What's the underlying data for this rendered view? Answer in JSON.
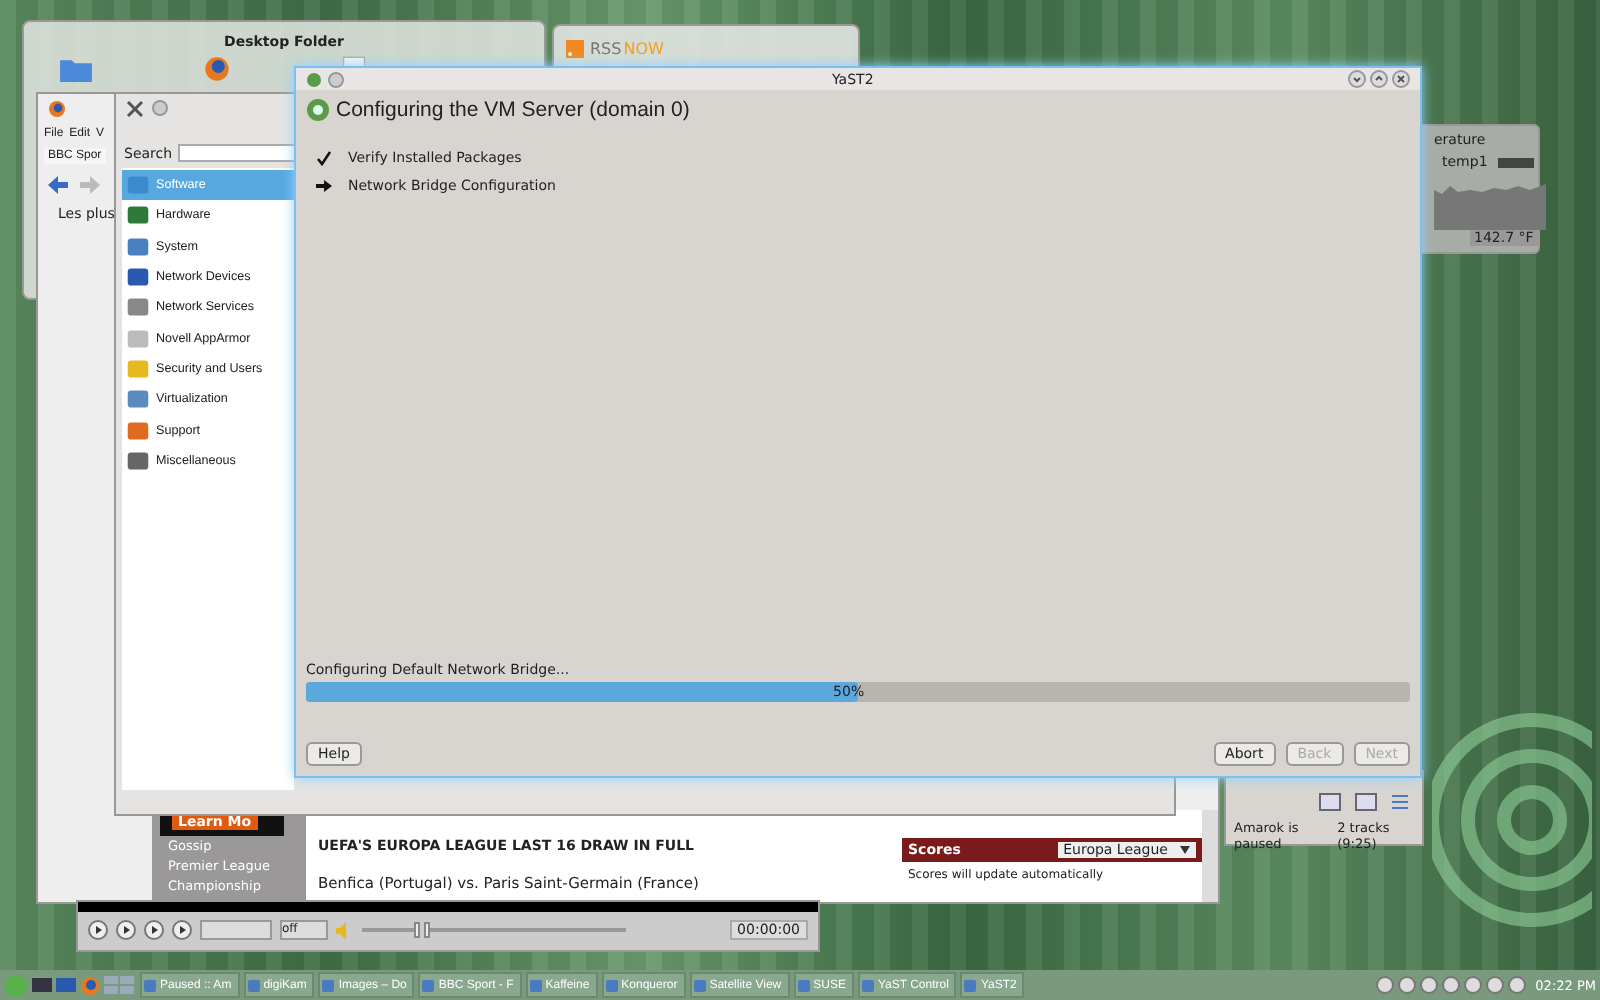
{
  "desktop_folder": {
    "title": "Desktop Folder"
  },
  "rss_widget": {
    "logo_left": "RSS",
    "logo_right": "NOW"
  },
  "browser": {
    "menu": [
      "File",
      "Edit",
      "V"
    ],
    "tab": "BBC Spor",
    "bookmark": "Les plus",
    "promo_button": "Learn Mo",
    "nav": [
      "Gossip",
      "Premier League",
      "Championship"
    ],
    "headline": "UEFA'S EUROPA LEAGUE LAST 16 DRAW IN FULL",
    "fixture": "Benfica (Portugal) vs. Paris Saint-Germain (France)",
    "scores": {
      "title": "Scores",
      "select": "Europa League",
      "note": "Scores will update automatically"
    }
  },
  "media_player": {
    "mode": "off",
    "volume": {
      "level": 0.95
    },
    "seek": {
      "level": 0
    },
    "time": "00:00:00"
  },
  "amarok": {
    "status": "Amarok is paused",
    "tracks": "2 tracks (9:25)"
  },
  "temperature_widget": {
    "title": "erature",
    "sensor": "temp1",
    "reading": "142.7 °F"
  },
  "control_center": {
    "search_label": "Search",
    "categories": [
      {
        "label": "Software",
        "selected": true
      },
      {
        "label": "Hardware",
        "selected": false
      },
      {
        "label": "System",
        "selected": false
      },
      {
        "label": "Network Devices",
        "selected": false
      },
      {
        "label": "Network Services",
        "selected": false
      },
      {
        "label": "Novell AppArmor",
        "selected": false
      },
      {
        "label": "Security and Users",
        "selected": false
      },
      {
        "label": "Virtualization",
        "selected": false
      },
      {
        "label": "Support",
        "selected": false
      },
      {
        "label": "Miscellaneous",
        "selected": false
      }
    ]
  },
  "yast_dialog": {
    "title": "YaST2",
    "heading": "Configuring the VM Server (domain 0)",
    "steps": [
      {
        "kind": "done",
        "label": "Verify Installed Packages"
      },
      {
        "kind": "current",
        "label": "Network Bridge Configuration"
      }
    ],
    "progress_label": "Configuring Default Network Bridge...",
    "progress": {
      "level": 0.5,
      "text": "50%"
    },
    "buttons": [
      {
        "label": "Help",
        "disabled": false
      },
      {
        "label": "Abort",
        "disabled": false
      },
      {
        "label": "Back",
        "disabled": true
      },
      {
        "label": "Next",
        "disabled": true
      }
    ]
  },
  "taskbar": {
    "tasks": [
      "Paused :: Am",
      "digiKam",
      "Images – Do",
      "BBC Sport - F",
      "Kaffeine",
      "Konqueror",
      "Satellite View",
      "SUSE",
      "YaST Control",
      "YaST2"
    ],
    "clock": "02:22 PM"
  }
}
